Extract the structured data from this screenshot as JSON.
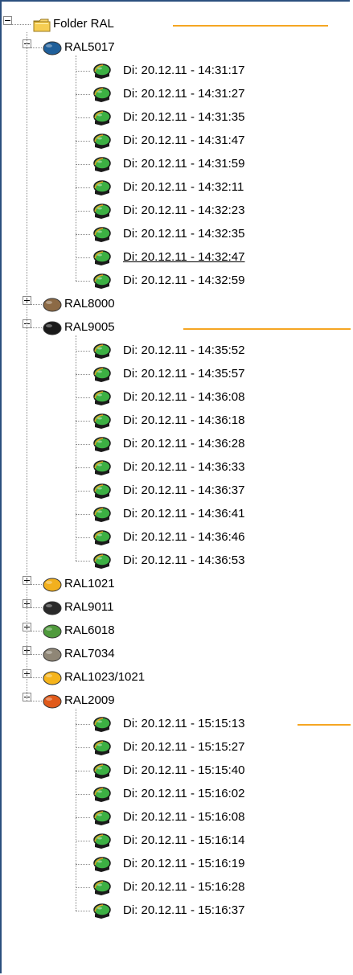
{
  "root": {
    "label": "Folder RAL",
    "icon": "folder-icon"
  },
  "groups": [
    {
      "label": "RAL5017",
      "color": "#1f5f9a",
      "expanded": true,
      "items": [
        "Di: 20.12.11 - 14:31:17",
        "Di: 20.12.11 - 14:31:27",
        "Di: 20.12.11 - 14:31:35",
        "Di: 20.12.11 - 14:31:47",
        "Di: 20.12.11 - 14:31:59",
        "Di: 20.12.11 - 14:32:11",
        "Di: 20.12.11 - 14:32:23",
        "Di: 20.12.11 - 14:32:35",
        "Di: 20.12.11 - 14:32:47",
        "Di: 20.12.11 - 14:32:59"
      ],
      "selected_index": 8
    },
    {
      "label": "RAL8000",
      "color": "#8c6a45",
      "expanded": false
    },
    {
      "label": "RAL9005",
      "color": "#1a1a1a",
      "expanded": true,
      "items": [
        "Di: 20.12.11 - 14:35:52",
        "Di: 20.12.11 - 14:35:57",
        "Di: 20.12.11 - 14:36:08",
        "Di: 20.12.11 - 14:36:18",
        "Di: 20.12.11 - 14:36:28",
        "Di: 20.12.11 - 14:36:33",
        "Di: 20.12.11 - 14:36:37",
        "Di: 20.12.11 - 14:36:41",
        "Di: 20.12.11 - 14:36:46",
        "Di: 20.12.11 - 14:36:53"
      ]
    },
    {
      "label": "RAL1021",
      "color": "#f2b01e",
      "expanded": false
    },
    {
      "label": "RAL9011",
      "color": "#2a2a2a",
      "expanded": false
    },
    {
      "label": "RAL6018",
      "color": "#4f9a3c",
      "expanded": false
    },
    {
      "label": "RAL7034",
      "color": "#8f8676",
      "expanded": false
    },
    {
      "label": "RAL1023/1021",
      "color": "#f5b41c",
      "expanded": false
    },
    {
      "label": "RAL2009",
      "color": "#e05a1a",
      "expanded": true,
      "items": [
        "Di: 20.12.11 - 15:15:13",
        "Di: 20.12.11 - 15:15:27",
        "Di: 20.12.11 - 15:15:40",
        "Di: 20.12.11 - 15:16:02",
        "Di: 20.12.11 - 15:16:08",
        "Di: 20.12.11 - 15:16:14",
        "Di: 20.12.11 - 15:16:19",
        "Di: 20.12.11 - 15:16:28",
        "Di: 20.12.11 - 15:16:37"
      ]
    }
  ],
  "item_icon_colors": {
    "fill": "#3cb043",
    "edge": "#1a1a1a",
    "accent": "#e0a020"
  },
  "annotation_color": "#f5a623"
}
